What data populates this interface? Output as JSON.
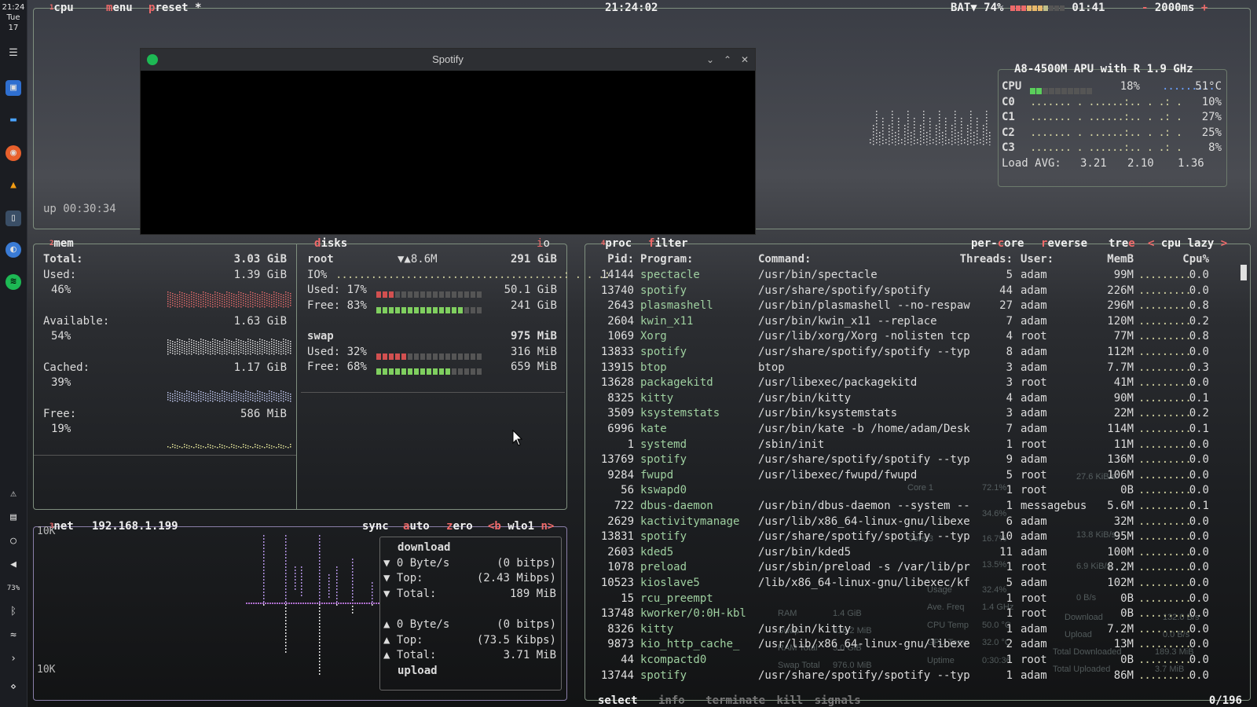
{
  "taskbar": {
    "time": "21:24",
    "day": "Tue",
    "date": "17",
    "icons": [
      "settings-icon",
      "store-icon",
      "files-icon",
      "firefox-icon",
      "vlc-icon",
      "terminal-icon",
      "browser-icon",
      "spotify-icon"
    ],
    "tray": [
      "notifications-icon",
      "clipboard-icon",
      "bulb-icon",
      "volume-icon",
      "battery-icon",
      "bluetooth-icon",
      "wifi-icon",
      "expand-icon",
      "menu-icon"
    ],
    "battery_percent": "73%"
  },
  "top": {
    "tab_cpu": "cpu",
    "tab_menu": "menu",
    "tab_preset": "preset *",
    "clock": "21:24:02",
    "battery": "BAT▼ 74%",
    "battery_time": "01:41",
    "interval_minus": "-",
    "interval": "2000ms",
    "interval_plus": "+",
    "uptime": "up 00:30:34",
    "battery_segments": [
      1,
      1,
      1,
      1,
      1,
      1,
      1,
      0,
      0,
      0
    ]
  },
  "cpuinfo": {
    "model": "A8-4500M APU with R",
    "freq": "1.9 GHz",
    "rows": [
      {
        "label": "CPU",
        "pct": "18%",
        "temp": "51°C",
        "fill": 0.18
      },
      {
        "label": "C0",
        "pct": "10%"
      },
      {
        "label": "C1",
        "pct": "27%"
      },
      {
        "label": "C2",
        "pct": "25%"
      },
      {
        "label": "C3",
        "pct": "8%"
      }
    ],
    "load_label": "Load AVG:",
    "load1": "3.21",
    "load5": "2.10",
    "load15": "1.36"
  },
  "spotify_window": {
    "title": "Spotify"
  },
  "mem": {
    "tab_num": "2",
    "title": "mem",
    "total_label": "Total:",
    "total": "3.03 GiB",
    "used_label": "Used:",
    "used": "1.39 GiB",
    "used_pct": "46%",
    "avail_label": "Available:",
    "avail": "1.63 GiB",
    "avail_pct": "54%",
    "cached_label": "Cached:",
    "cached": "1.17 GiB",
    "cached_pct": "39%",
    "free_label": "Free:",
    "free": "586 MiB",
    "free_pct": "19%"
  },
  "disks": {
    "title": "disks",
    "io_tab": "io",
    "root_label": "root",
    "root_io": "▼▲8.6M",
    "root_size": "291 GiB",
    "io_label": "IO%",
    "used_label": "Used:",
    "used_pct": "17%",
    "used": "50.1 GiB",
    "used_fill": 0.17,
    "free_label": "Free:",
    "free_pct": "83%",
    "free": "241 GiB",
    "free_fill": 0.83,
    "swap_label": "swap",
    "swap_size": "975 MiB",
    "swap_used_pct": "32%",
    "swap_used": "316 MiB",
    "swap_used_fill": 0.32,
    "swap_free_pct": "68%",
    "swap_free": "659 MiB",
    "swap_free_fill": 0.68
  },
  "net": {
    "tab_num": "3",
    "title": "net",
    "ip": "192.168.1.199",
    "sync": "sync",
    "auto": "auto",
    "zero": "zero",
    "iface_prev": "<b",
    "iface": "wlo1",
    "iface_next": "n>",
    "scale_top": "10K",
    "scale_bottom": "10K",
    "download_label": "download",
    "dl_rate": "0 Byte/s",
    "dl_bits": "(0 bitps)",
    "dl_top_label": "Top:",
    "dl_top": "(2.43 Mibps)",
    "dl_total_label": "Total:",
    "dl_total": "189 MiB",
    "ul_rate": "0 Byte/s",
    "ul_bits": "(0 bitps)",
    "ul_top_label": "Top:",
    "ul_top": "(73.5 Kibps)",
    "ul_total_label": "Total:",
    "ul_total": "3.71 MiB",
    "upload_label": "upload"
  },
  "proc": {
    "tab_num": "4",
    "title": "proc",
    "filter": "filter",
    "per_core": "per-core",
    "reverse": "reverse",
    "tree": "tree",
    "sort_prev": "<",
    "sort": "cpu lazy",
    "sort_next": ">",
    "headers": {
      "pid": "Pid:",
      "program": "Program:",
      "command": "Command:",
      "threads": "Threads:",
      "user": "User:",
      "mem": "MemB",
      "cpu": "Cpu%"
    },
    "rows": [
      {
        "pid": "14144",
        "program": "spectacle",
        "command": "/usr/bin/spectacle",
        "threads": "5",
        "user": "adam",
        "mem": "99M",
        "cpu": "0.0"
      },
      {
        "pid": "13740",
        "program": "spotify",
        "command": "/usr/share/spotify/spotify",
        "threads": "44",
        "user": "adam",
        "mem": "226M",
        "cpu": "0.0"
      },
      {
        "pid": "2643",
        "program": "plasmashell",
        "command": "/usr/bin/plasmashell --no-respaw",
        "threads": "27",
        "user": "adam",
        "mem": "296M",
        "cpu": "0.8"
      },
      {
        "pid": "2604",
        "program": "kwin_x11",
        "command": "/usr/bin/kwin_x11 --replace",
        "threads": "7",
        "user": "adam",
        "mem": "120M",
        "cpu": "0.2"
      },
      {
        "pid": "1069",
        "program": "Xorg",
        "command": "/usr/lib/xorg/Xorg -nolisten tcp",
        "threads": "4",
        "user": "root",
        "mem": "77M",
        "cpu": "0.8"
      },
      {
        "pid": "13833",
        "program": "spotify",
        "command": "/usr/share/spotify/spotify --typ",
        "threads": "8",
        "user": "adam",
        "mem": "112M",
        "cpu": "0.0"
      },
      {
        "pid": "13915",
        "program": "btop",
        "command": "btop",
        "threads": "3",
        "user": "adam",
        "mem": "7.7M",
        "cpu": "0.3"
      },
      {
        "pid": "13628",
        "program": "packagekitd",
        "command": "/usr/libexec/packagekitd",
        "threads": "3",
        "user": "root",
        "mem": "41M",
        "cpu": "0.0"
      },
      {
        "pid": "8325",
        "program": "kitty",
        "command": "/usr/bin/kitty",
        "threads": "4",
        "user": "adam",
        "mem": "90M",
        "cpu": "0.1"
      },
      {
        "pid": "3509",
        "program": "ksystemstats",
        "command": "/usr/bin/ksystemstats",
        "threads": "3",
        "user": "adam",
        "mem": "22M",
        "cpu": "0.2"
      },
      {
        "pid": "6996",
        "program": "kate",
        "command": "/usr/bin/kate -b /home/adam/Desk",
        "threads": "7",
        "user": "adam",
        "mem": "114M",
        "cpu": "0.1"
      },
      {
        "pid": "1",
        "program": "systemd",
        "command": "/sbin/init",
        "threads": "1",
        "user": "root",
        "mem": "11M",
        "cpu": "0.0"
      },
      {
        "pid": "13769",
        "program": "spotify",
        "command": "/usr/share/spotify/spotify --typ",
        "threads": "9",
        "user": "adam",
        "mem": "136M",
        "cpu": "0.0"
      },
      {
        "pid": "9284",
        "program": "fwupd",
        "command": "/usr/libexec/fwupd/fwupd",
        "threads": "5",
        "user": "root",
        "mem": "106M",
        "cpu": "0.0"
      },
      {
        "pid": "56",
        "program": "kswapd0",
        "command": "",
        "threads": "1",
        "user": "root",
        "mem": "0B",
        "cpu": "0.0"
      },
      {
        "pid": "722",
        "program": "dbus-daemon",
        "command": "/usr/bin/dbus-daemon --system --",
        "threads": "1",
        "user": "messagebus",
        "mem": "5.6M",
        "cpu": "0.1"
      },
      {
        "pid": "2629",
        "program": "kactivitymanage",
        "command": "/usr/lib/x86_64-linux-gnu/libexe",
        "threads": "6",
        "user": "adam",
        "mem": "32M",
        "cpu": "0.0"
      },
      {
        "pid": "13831",
        "program": "spotify",
        "command": "/usr/share/spotify/spotify --typ",
        "threads": "10",
        "user": "adam",
        "mem": "95M",
        "cpu": "0.0"
      },
      {
        "pid": "2603",
        "program": "kded5",
        "command": "/usr/bin/kded5",
        "threads": "11",
        "user": "adam",
        "mem": "100M",
        "cpu": "0.0"
      },
      {
        "pid": "1078",
        "program": "preload",
        "command": "/usr/sbin/preload -s /var/lib/pr",
        "threads": "1",
        "user": "root",
        "mem": "8.2M",
        "cpu": "0.0"
      },
      {
        "pid": "10523",
        "program": "kioslave5",
        "command": "/lib/x86_64-linux-gnu/libexec/kf",
        "threads": "5",
        "user": "adam",
        "mem": "102M",
        "cpu": "0.0"
      },
      {
        "pid": "15",
        "program": "rcu_preempt",
        "command": "",
        "threads": "1",
        "user": "root",
        "mem": "0B",
        "cpu": "0.0"
      },
      {
        "pid": "13748",
        "program": "kworker/0:0H-kbl",
        "command": "",
        "threads": "1",
        "user": "root",
        "mem": "0B",
        "cpu": "0.0"
      },
      {
        "pid": "8326",
        "program": "kitty",
        "command": "/usr/bin/kitty",
        "threads": "1",
        "user": "adam",
        "mem": "7.2M",
        "cpu": "0.0"
      },
      {
        "pid": "9873",
        "program": "kio_http_cache_",
        "command": "/usr/lib/x86_64-linux-gnu/libexe",
        "threads": "2",
        "user": "adam",
        "mem": "13M",
        "cpu": "0.0"
      },
      {
        "pid": "44",
        "program": "kcompactd0",
        "command": "",
        "threads": "1",
        "user": "root",
        "mem": "0B",
        "cpu": "0.0"
      },
      {
        "pid": "13744",
        "program": "spotify",
        "command": "/usr/share/spotify/spotify --typ",
        "threads": "1",
        "user": "adam",
        "mem": "86M",
        "cpu": "0.0"
      }
    ],
    "footer_select": "select",
    "footer_info": "info",
    "footer_terminate": "terminate",
    "footer_kill": "kill",
    "footer_signals": "signals",
    "count": "0/196"
  },
  "bg_widget": {
    "core1": "Core 1",
    "core1_pct": "72.1%",
    "core3": "Core 3",
    "core3_pct": "16.7%",
    "usage": "Usage",
    "usage_val": "32.4%",
    "ave_freq": "Ave. Freq",
    "ave_freq_val": "1.4 GHz",
    "cpu_temp": "CPU Temp",
    "cpu_temp_val": "50.0 °C",
    "gpu_temp": "GPU Temp",
    "gpu_temp_val": "32.0 °C",
    "ram": "RAM",
    "ram_val": "1.4 GiB",
    "swap": "Swap",
    "swap_val": "316.2 MiB",
    "ram_total": "RAM Total",
    "ram_total_val": "3.0 GiB",
    "swap_total": "Swap Total",
    "swap_total_val": "976.0 MiB",
    "uptime": "Uptime",
    "uptime_val": "0:30:36",
    "rate1": "27.6 KiB/s",
    "rate2": "13.8 KiB/s",
    "rate3": "6.9 KiB/s",
    "rate4": "0 B/s",
    "download": "Download",
    "download_val": "132.0 B/s",
    "upload": "Upload",
    "upload_val": "0.0 B/s",
    "total_dl": "Total Downloaded",
    "total_dl_val": "189.3 MiB",
    "total_ul": "Total Uploaded",
    "total_ul_val": "3.7 MiB",
    "pct13": "13.5%",
    "pct34": "34.6%"
  },
  "colors": {
    "border": "#7f8f7f",
    "accent": "#ee6a6a",
    "green": "#5bcf5b",
    "label": "#f0f0f0"
  }
}
